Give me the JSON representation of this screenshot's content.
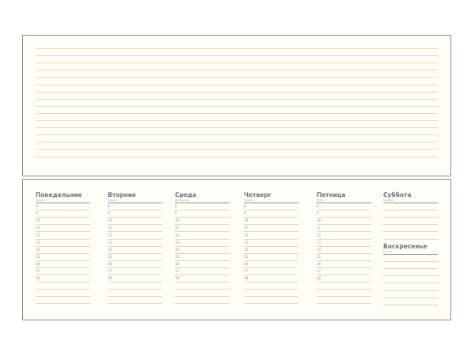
{
  "days": [
    {
      "name": "Понедельник",
      "sub": "Monday",
      "hours": [
        "8",
        "9",
        "10",
        "11",
        "12",
        "13",
        "14",
        "15",
        "16",
        "17",
        "18"
      ]
    },
    {
      "name": "Вторник",
      "sub": "Tuesday",
      "hours": [
        "8",
        "9",
        "10",
        "11",
        "12",
        "13",
        "14",
        "15",
        "16",
        "17",
        "18"
      ]
    },
    {
      "name": "Среда",
      "sub": "Wednesday",
      "hours": [
        "8",
        "9",
        "10",
        "11",
        "12",
        "13",
        "14",
        "15",
        "16",
        "17",
        "18"
      ]
    },
    {
      "name": "Четверг",
      "sub": "Thursday",
      "hours": [
        "8",
        "9",
        "10",
        "11",
        "12",
        "13",
        "14",
        "15",
        "16",
        "17",
        "18"
      ]
    },
    {
      "name": "Пятница",
      "sub": "Friday",
      "hours": [
        "8",
        "9",
        "10",
        "11",
        "12",
        "13",
        "14",
        "15",
        "16",
        "17",
        "18"
      ]
    },
    {
      "name": "Суббота",
      "sub": "Saturday",
      "hours": []
    },
    {
      "name": "Воскресенье",
      "sub": "Sunday",
      "hours": []
    }
  ]
}
